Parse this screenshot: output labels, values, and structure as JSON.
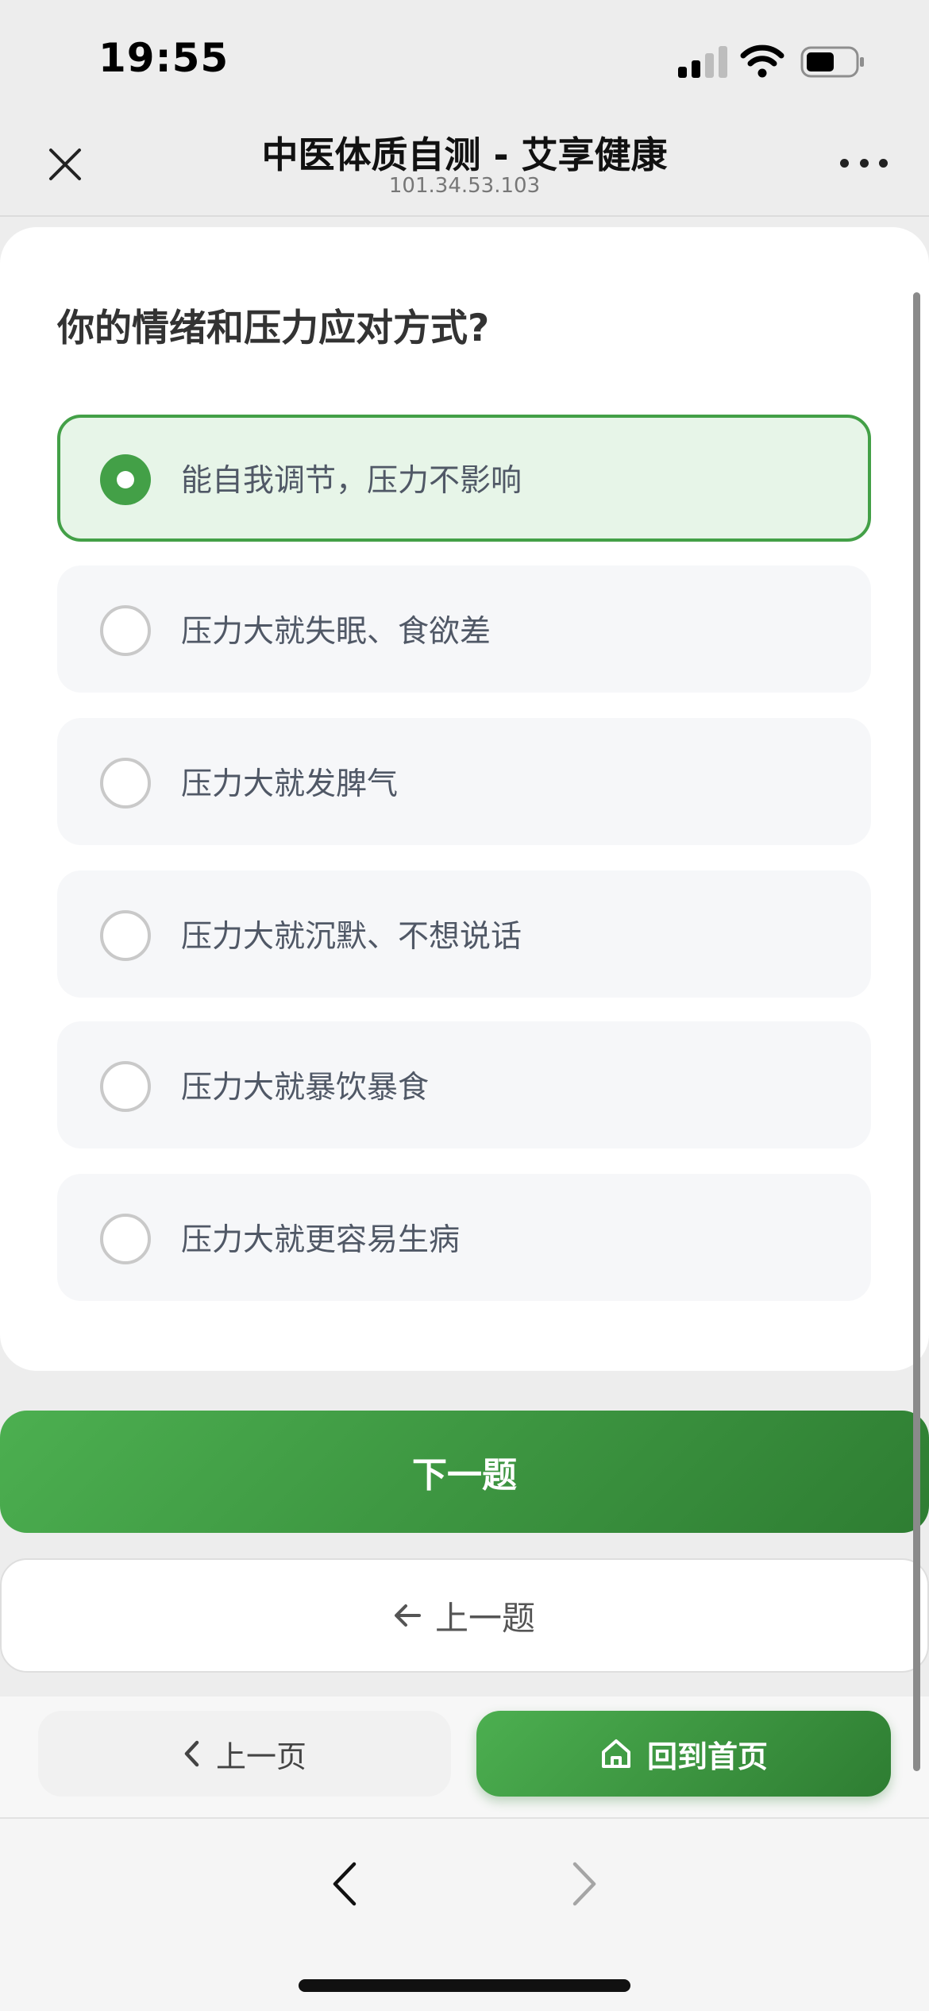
{
  "status_bar": {
    "time": "19:55"
  },
  "nav": {
    "title": "中医体质自测 - 艾享健康",
    "subtitle": "101.34.53.103"
  },
  "question": {
    "text": "你的情绪和压力应对方式?",
    "options": [
      {
        "label": "能自我调节，压力不影响",
        "selected": true
      },
      {
        "label": "压力大就失眠、食欲差",
        "selected": false
      },
      {
        "label": "压力大就发脾气",
        "selected": false
      },
      {
        "label": "压力大就沉默、不想说话",
        "selected": false
      },
      {
        "label": "压力大就暴饮暴食",
        "selected": false
      },
      {
        "label": "压力大就更容易生病",
        "selected": false
      }
    ]
  },
  "buttons": {
    "next": "下一题",
    "prev": "上一题"
  },
  "bottom_bar": {
    "prev_page": "上一页",
    "home": "回到首页"
  },
  "colors": {
    "accent": "#43a047",
    "accent_dark": "#2e7d32",
    "selected_bg": "#e7f5e8",
    "option_bg": "#f6f7f9"
  },
  "icons": {
    "nav_close": "close-icon",
    "nav_more": "more-dots-icon",
    "prev_arrow": "arrow-left-icon",
    "prev_page": "chevron-left-icon",
    "home": "home-icon",
    "browser_back": "chevron-left-icon",
    "browser_forward": "chevron-right-icon"
  }
}
